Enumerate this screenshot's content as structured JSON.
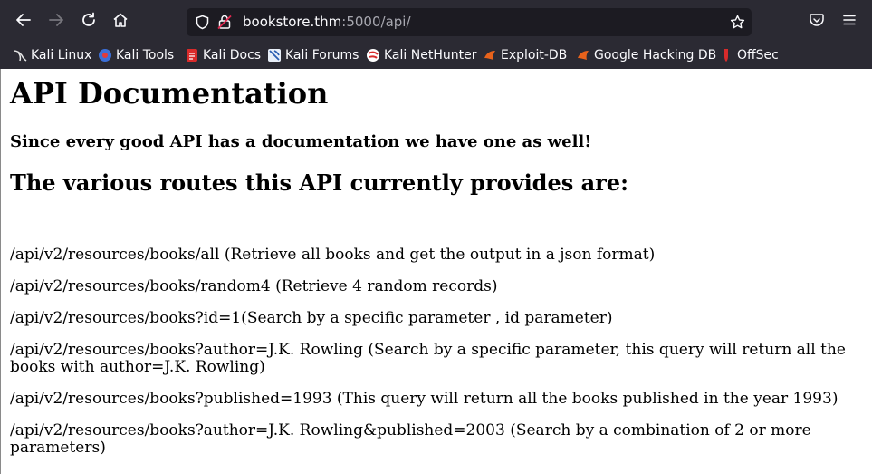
{
  "browser": {
    "url_host": "bookstore.thm",
    "url_rest": ":5000/api/",
    "bookmarks": [
      {
        "label": "Kali Linux",
        "icon": "kali-dragon-icon"
      },
      {
        "label": "Kali Tools",
        "icon": "kali-tools-icon"
      },
      {
        "label": "Kali Docs",
        "icon": "kali-docs-icon"
      },
      {
        "label": "Kali Forums",
        "icon": "kali-forums-icon"
      },
      {
        "label": "Kali NetHunter",
        "icon": "nethunter-icon"
      },
      {
        "label": "Exploit-DB",
        "icon": "exploit-db-icon"
      },
      {
        "label": "Google Hacking DB",
        "icon": "ghdb-icon"
      },
      {
        "label": "OffSec",
        "icon": "offsec-icon"
      }
    ]
  },
  "page": {
    "title": "API Documentation",
    "subtitle": "Since every good API has a documentation we have one as well!",
    "routes_heading": "The various routes this API currently provides are:",
    "routes": [
      "/api/v2/resources/books/all (Retrieve all books and get the output in a json format)",
      "/api/v2/resources/books/random4 (Retrieve 4 random records)",
      "/api/v2/resources/books?id=1(Search by a specific parameter , id parameter)",
      "/api/v2/resources/books?author=J.K. Rowling (Search by a specific parameter, this query will return all the books with author=J.K. Rowling)",
      "/api/v2/resources/books?published=1993 (This query will return all the books published in the year 1993)",
      "/api/v2/resources/books?author=J.K. Rowling&published=2003 (Search by a combination of 2 or more parameters)"
    ]
  }
}
